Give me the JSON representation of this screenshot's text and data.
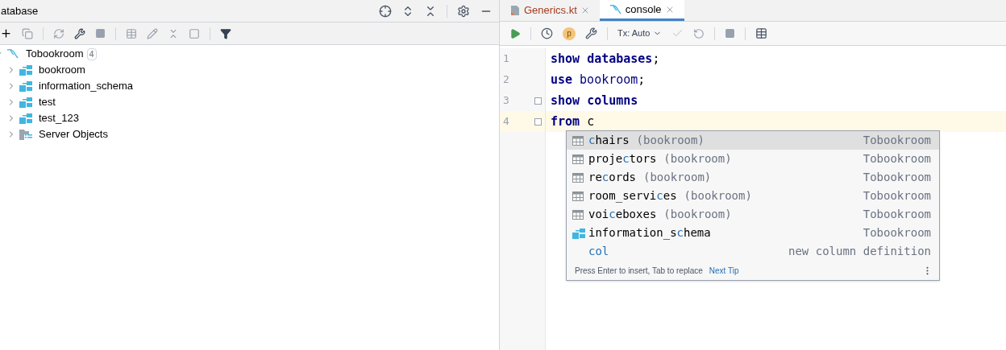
{
  "database_panel": {
    "title": "atabase",
    "tree": [
      {
        "label": "Tobookroom",
        "badge": "4",
        "kind": "connection",
        "expanded": true,
        "children": [
          {
            "label": "bookroom",
            "kind": "schema",
            "expanded": false
          },
          {
            "label": "information_schema",
            "kind": "schema",
            "expanded": false
          },
          {
            "label": "test",
            "kind": "schema",
            "expanded": false
          },
          {
            "label": "test_123",
            "kind": "schema",
            "expanded": false
          },
          {
            "label": "Server Objects",
            "kind": "folder",
            "expanded": false
          }
        ]
      }
    ]
  },
  "editor": {
    "tabs": [
      {
        "label": "Generics.kt",
        "kind": "kotlin",
        "selected": false
      },
      {
        "label": "console",
        "kind": "sql",
        "selected": true
      }
    ],
    "parameter_label": "p",
    "tx_mode": "Tx: Auto",
    "lines": [
      {
        "number": "1",
        "current": false,
        "fold": false,
        "tokens": [
          {
            "text": "show",
            "kind": "keyword"
          },
          {
            "text": "databases",
            "kind": "keyword"
          },
          {
            "text": ";",
            "kind": "punct"
          }
        ]
      },
      {
        "number": "2",
        "current": false,
        "fold": false,
        "tokens": [
          {
            "text": "use",
            "kind": "keyword"
          },
          {
            "text": "bookroom",
            "kind": "plain"
          },
          {
            "text": ";",
            "kind": "punct"
          }
        ]
      },
      {
        "number": "3",
        "current": false,
        "fold": true,
        "tokens": [
          {
            "text": "show",
            "kind": "keyword"
          },
          {
            "text": "columns",
            "kind": "keyword"
          }
        ]
      },
      {
        "number": "4",
        "current": true,
        "fold": true,
        "tokens": [
          {
            "text": "from",
            "kind": "keyword"
          },
          {
            "text": "c",
            "kind": "typed"
          }
        ]
      }
    ],
    "completion": {
      "items": [
        {
          "kind": "table",
          "parts": [
            {
              "text": "c",
              "match": true
            },
            {
              "text": "hairs",
              "match": false
            }
          ],
          "qualifier": "(bookroom)",
          "source": "Tobookroom",
          "selected": true
        },
        {
          "kind": "table",
          "parts": [
            {
              "text": "proje",
              "match": false
            },
            {
              "text": "c",
              "match": true
            },
            {
              "text": "tors",
              "match": false
            }
          ],
          "qualifier": "(bookroom)",
          "source": "Tobookroom",
          "selected": false
        },
        {
          "kind": "table",
          "parts": [
            {
              "text": "re",
              "match": false
            },
            {
              "text": "c",
              "match": true
            },
            {
              "text": "ords",
              "match": false
            }
          ],
          "qualifier": "(bookroom)",
          "source": "Tobookroom",
          "selected": false
        },
        {
          "kind": "table",
          "parts": [
            {
              "text": "room_servi",
              "match": false
            },
            {
              "text": "c",
              "match": true
            },
            {
              "text": "es",
              "match": false
            }
          ],
          "qualifier": "(bookroom)",
          "source": "Tobookroom",
          "selected": false
        },
        {
          "kind": "table",
          "parts": [
            {
              "text": "voi",
              "match": false
            },
            {
              "text": "c",
              "match": true
            },
            {
              "text": "eboxes",
              "match": false
            }
          ],
          "qualifier": "(bookroom)",
          "source": "Tobookroom",
          "selected": false
        },
        {
          "kind": "schema",
          "parts": [
            {
              "text": "information_s",
              "match": false
            },
            {
              "text": "c",
              "match": true
            },
            {
              "text": "hema",
              "match": false
            }
          ],
          "source": "Tobookroom",
          "selected": false
        },
        {
          "kind": "keyword",
          "parts": [
            {
              "text": "col",
              "match": true
            }
          ],
          "source": "new column definition",
          "selected": false
        }
      ],
      "hint": "Press Enter to insert, Tab to replace",
      "hint_link": "Next Tip"
    }
  }
}
